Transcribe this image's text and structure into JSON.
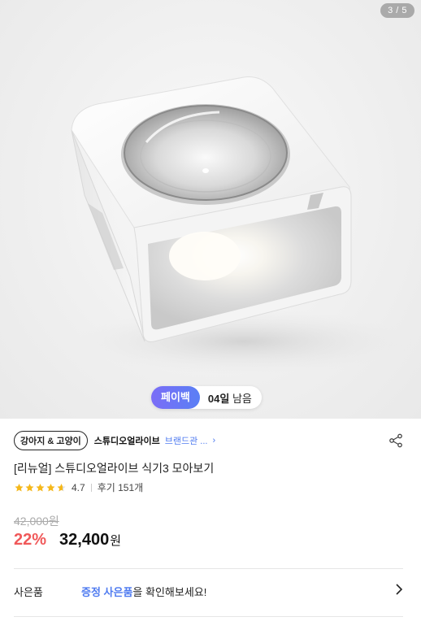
{
  "gallery": {
    "counter": "3 / 5"
  },
  "payback": {
    "tag": "페이백",
    "days_num": "04일",
    "days_suffix": "남음"
  },
  "brand": {
    "category": "강아지 & 고양이",
    "name": "스튜디오얼라이브",
    "link": "브랜드관 ...",
    "arrow": "›"
  },
  "product": {
    "title": "[리뉴얼] 스튜디오얼라이브 식기3 모아보기",
    "rating": 4.7,
    "rating_text": "4.7",
    "reviews": "후기 151개",
    "original_price": "42,000원",
    "discount": "22%",
    "price": "32,400",
    "price_unit": "원"
  },
  "gift": {
    "label": "사은품",
    "highlight": "증정 사은품",
    "rest": "을 확인해보세요!"
  },
  "colors": {
    "accent": "#4f7bf0",
    "discount": "#f0595a",
    "star": "#f5b81b"
  }
}
